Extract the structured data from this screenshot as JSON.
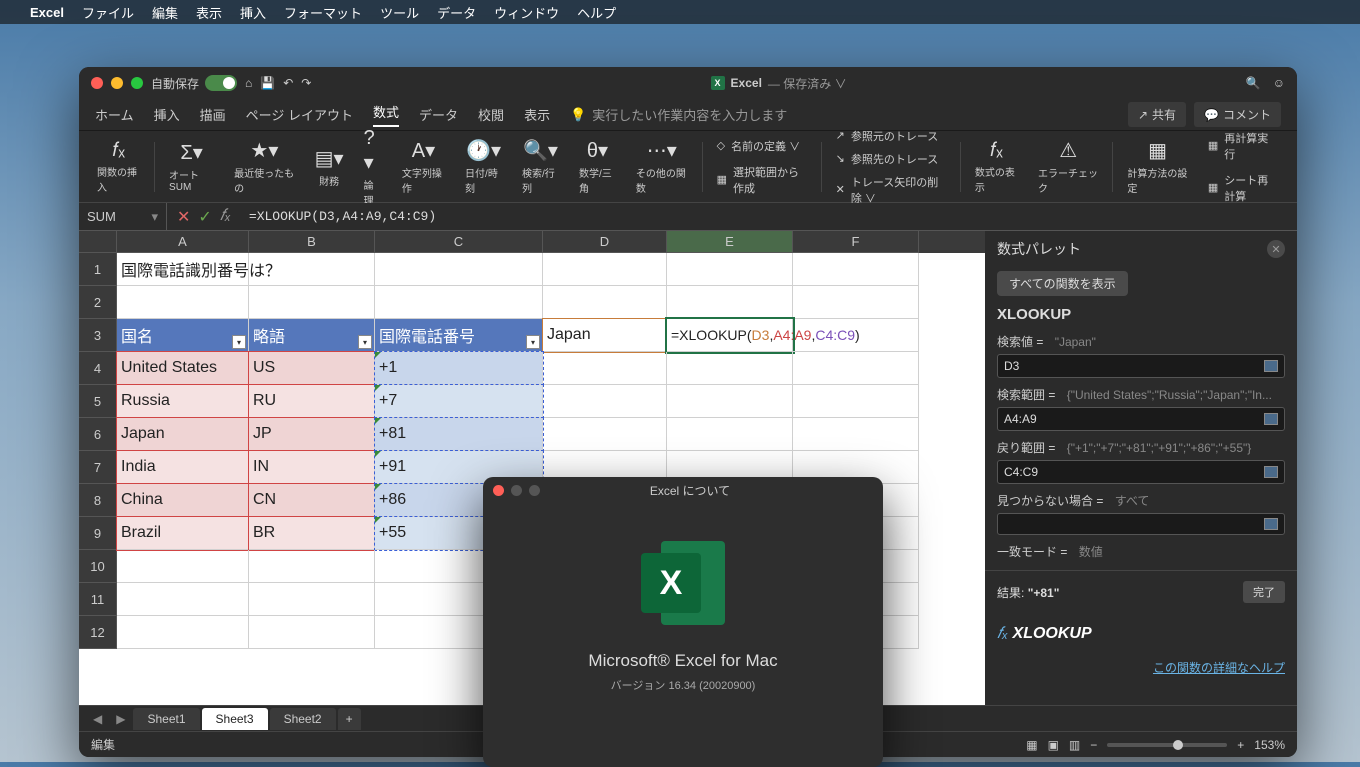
{
  "menubar": {
    "items": [
      "Excel",
      "ファイル",
      "編集",
      "表示",
      "挿入",
      "フォーマット",
      "ツール",
      "データ",
      "ウィンドウ",
      "ヘルプ"
    ]
  },
  "titlebar": {
    "autosave_label": "自動保存",
    "app": "Excel",
    "saved": "— 保存済み ∨"
  },
  "ribbon_tabs": {
    "items": [
      "ホーム",
      "挿入",
      "描画",
      "ページ レイアウト",
      "数式",
      "データ",
      "校閲",
      "表示"
    ],
    "active": 4,
    "tellme": "実行したい作業内容を入力します",
    "share": "共有",
    "comment": "コメント"
  },
  "ribbon": {
    "groups": [
      "関数の挿入",
      "オートSUM",
      "最近使ったもの",
      "財務",
      "論理",
      "文字列操作",
      "日付/時刻",
      "検索/行列",
      "数学/三角",
      "その他の関数"
    ],
    "mid_items": [
      "名前の定義 ∨",
      "選択範囲から作成"
    ],
    "trace_items": [
      "参照元のトレース",
      "参照先のトレース",
      "トレース矢印の削除 ∨"
    ],
    "opts": [
      "数式の表示",
      "エラーチェック",
      "計算方法の設定"
    ],
    "recalc": [
      "再計算実行",
      "シート再計算"
    ]
  },
  "formula_bar": {
    "name": "SUM",
    "formula": "=XLOOKUP(D3,A4:A9,C4:C9)"
  },
  "columns": [
    "A",
    "B",
    "C",
    "D",
    "E",
    "F"
  ],
  "rows": [
    "1",
    "2",
    "3",
    "4",
    "5",
    "6",
    "7",
    "8",
    "9",
    "10",
    "11",
    "12"
  ],
  "sheet": {
    "a1": "国際電話識別番号は？",
    "headers": {
      "country": "国名",
      "abbr": "略語",
      "dial": "国際電話番号"
    },
    "d3": "Japan",
    "e3_parts": {
      "fn": "=XLOOKUP(",
      "a1": "D3",
      "c1": ",",
      "a2": "A4:A9",
      "c2": ",",
      "a3": "C4:C9",
      "close": ")"
    },
    "data": [
      {
        "country": "United States",
        "abbr": "US",
        "dial": "+1"
      },
      {
        "country": "Russia",
        "abbr": "RU",
        "dial": "+7"
      },
      {
        "country": "Japan",
        "abbr": "JP",
        "dial": "+81"
      },
      {
        "country": "India",
        "abbr": "IN",
        "dial": "+91"
      },
      {
        "country": "China",
        "abbr": "CN",
        "dial": "+86"
      },
      {
        "country": "Brazil",
        "abbr": "BR",
        "dial": "+55"
      }
    ]
  },
  "palette": {
    "title": "数式パレット",
    "show_all": "すべての関数を表示",
    "fn": "XLOOKUP",
    "args": [
      {
        "label": "検索値",
        "hint": "\"Japan\"",
        "value": "D3"
      },
      {
        "label": "検索範囲",
        "hint": "{\"United States\";\"Russia\";\"Japan\";\"In...",
        "value": "A4:A9"
      },
      {
        "label": "戻り範囲",
        "hint": "{\"+1\";\"+7\";\"+81\";\"+91\";\"+86\";\"+55\"}",
        "value": "C4:C9"
      },
      {
        "label": "見つからない場合",
        "hint": "すべて",
        "value": ""
      },
      {
        "label": "一致モード",
        "hint": "数値",
        "value": ""
      }
    ],
    "result_label": "結果:",
    "result": "\"+81\"",
    "done": "完了",
    "fx_label": "XLOOKUP",
    "help": "この関数の詳細なヘルプ"
  },
  "sheet_tabs": {
    "items": [
      "Sheet1",
      "Sheet3",
      "Sheet2"
    ],
    "active": 1,
    "plus": "+"
  },
  "statusbar": {
    "mode": "編集",
    "zoom": "153%"
  },
  "about": {
    "title": "Excel について",
    "product": "Microsoft® Excel for Mac",
    "version": "バージョン 16.34 (20020900)"
  }
}
